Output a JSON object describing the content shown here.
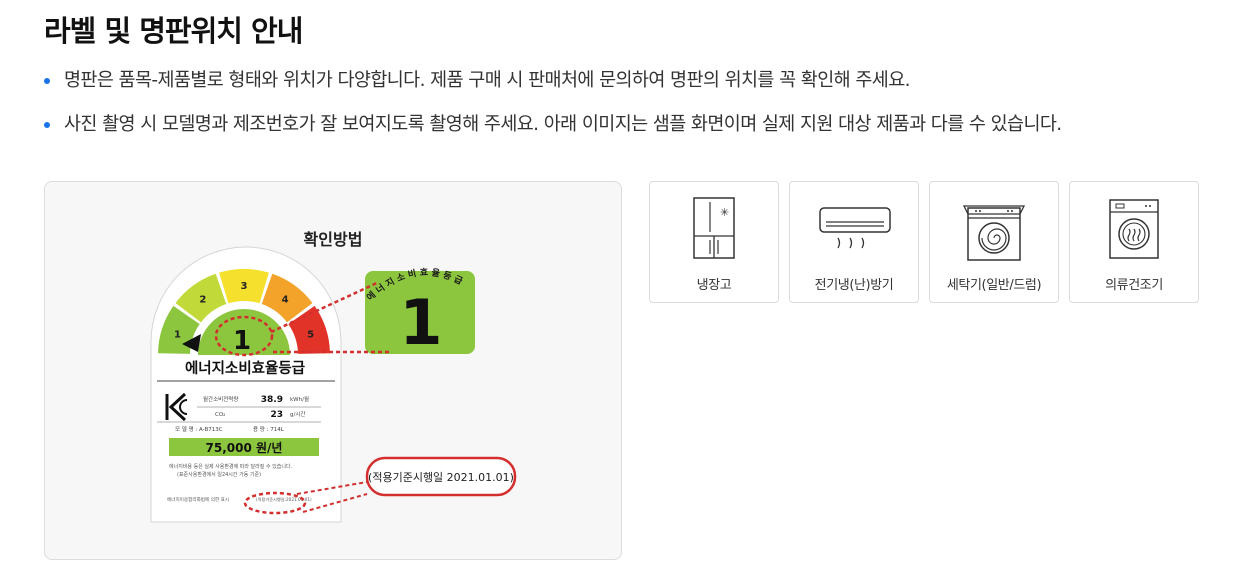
{
  "page": {
    "title": "라벨 및 명판위치 안내"
  },
  "notes": [
    "명판은 품목-제품별로 형태와 위치가 다양합니다. 제품 구매 시 판매처에 문의하여 명판의 위치를 꼭 확인해 주세요.",
    "사진 촬영 시 모델명과 제조번호가 잘 보여지도록 촬영해 주세요. 아래 이미지는 샘플 화면이며 실제 지원 대상 제품과 다를 수 있습니다."
  ],
  "guide": {
    "title": "확인방법",
    "label": {
      "grade_numbers": [
        "1",
        "2",
        "3",
        "4",
        "5"
      ],
      "current_grade": "1",
      "zoom_grade": "1",
      "zoom_arc_text": "에 너 지 소 비 효 율 등 급",
      "main_title": "에너지소비효율등급",
      "rows": [
        {
          "label": "월간소비전력량",
          "value": "38.9",
          "unit": "kWh/월"
        },
        {
          "label": "CO₂",
          "value": "23",
          "unit": "g/시간"
        }
      ],
      "model_label": "모 델 명 : A-B713C",
      "capacity_label": "용   량 : 714L",
      "cost": "75,000 원/년",
      "note1": "에너지비용 등은 실제 사용환경에 따라 달라질 수 있습니다.",
      "note2": "(표준사용환경에서 일24시간 가동 기준)",
      "footer_text": "에너지이용합리화법에 의한 표시",
      "footer_date_small": "(적용기준시행일:2021.01.01)",
      "callout_date": "(적용기준시행일 2021.01.01)"
    },
    "colors": {
      "grade1": "#8cc63f",
      "grade2": "#c2d93a",
      "grade3": "#f5e12d",
      "grade4": "#f4a32a",
      "grade5": "#e23328",
      "callout_red": "#d32f2f",
      "accent_blue": "#1a73e8"
    }
  },
  "products": [
    {
      "name": "냉장고",
      "icon": "refrigerator-icon"
    },
    {
      "name": "전기냉(난)방기",
      "icon": "air-conditioner-icon"
    },
    {
      "name": "세탁기(일반/드럼)",
      "icon": "washing-machine-icon"
    },
    {
      "name": "의류건조기",
      "icon": "clothes-dryer-icon"
    }
  ]
}
